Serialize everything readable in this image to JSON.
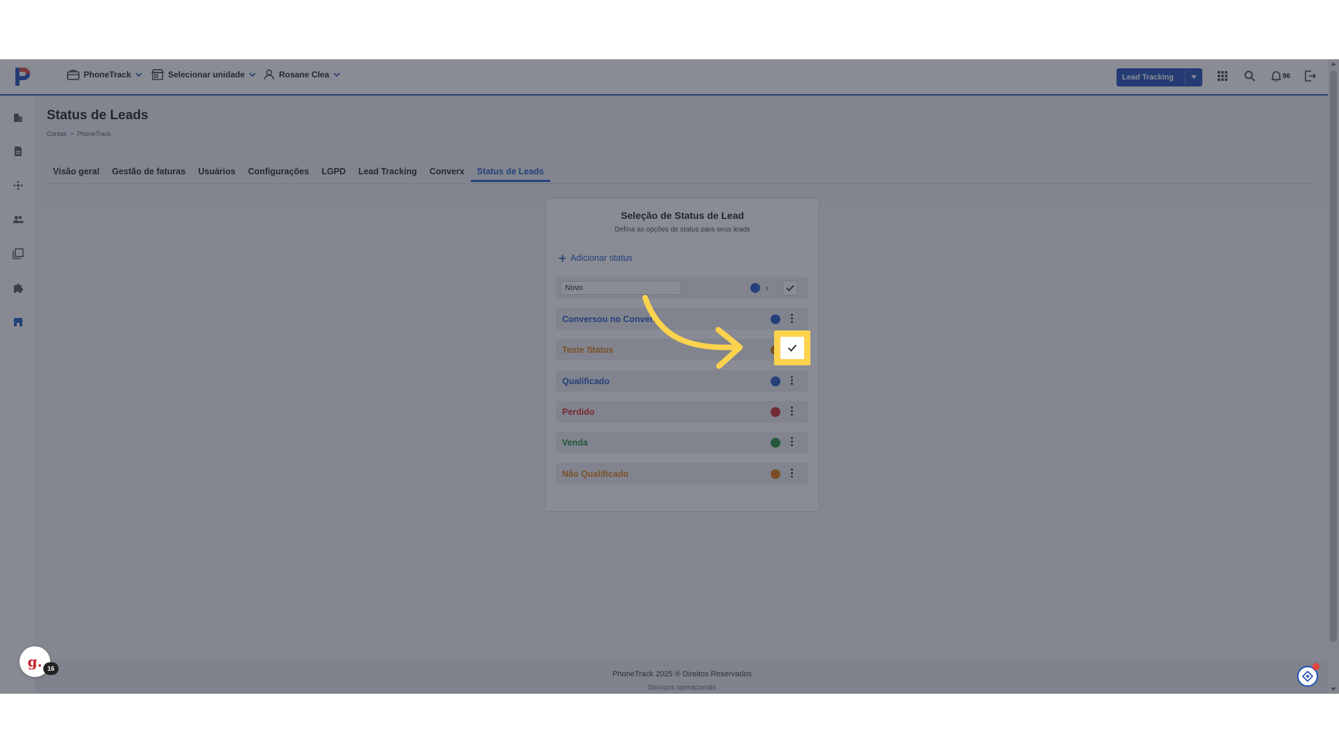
{
  "topbar": {
    "menu_phonetrack": "PhoneTrack",
    "menu_unit": "Selecionar unidade",
    "menu_user": "Rosane Clea",
    "lead_tracking_button": "Lead Tracking",
    "notifications_count": "96"
  },
  "page": {
    "title": "Status de Leads",
    "breadcrumb": [
      "Contas",
      ">",
      "PhoneTrack"
    ]
  },
  "tabs": [
    {
      "label": "Visão geral"
    },
    {
      "label": "Gestão de faturas"
    },
    {
      "label": "Usuários"
    },
    {
      "label": "Configurações"
    },
    {
      "label": "LGPD"
    },
    {
      "label": "Lead Tracking"
    },
    {
      "label": "Converx"
    },
    {
      "label": "Status de Leads"
    }
  ],
  "card": {
    "title": "Seleção de Status de Lead",
    "subtitle": "Defina as opções de status para seus leads",
    "add_status": "Adicionar status",
    "edit_input_value": "Novo",
    "statuses": [
      {
        "label": "Conversou no Converx",
        "color": "#2255c8"
      },
      {
        "label": "Teste Status",
        "color": "#e07a10"
      },
      {
        "label": "Qualificado",
        "color": "#2255c8"
      },
      {
        "label": "Perdido",
        "color": "#d0262c"
      },
      {
        "label": "Venda",
        "color": "#1f8a3a"
      },
      {
        "label": "Não Qualificado",
        "color": "#e07a10"
      }
    ]
  },
  "footer": {
    "text": "PhoneTrack 2025 ® Direitos Reservados",
    "sub": "Serviços operacionais"
  },
  "widgets": {
    "g_badge": "g.",
    "g_count": "16"
  },
  "colors": {
    "accent": "#1f4fb5",
    "highlight": "#fcd34d"
  }
}
